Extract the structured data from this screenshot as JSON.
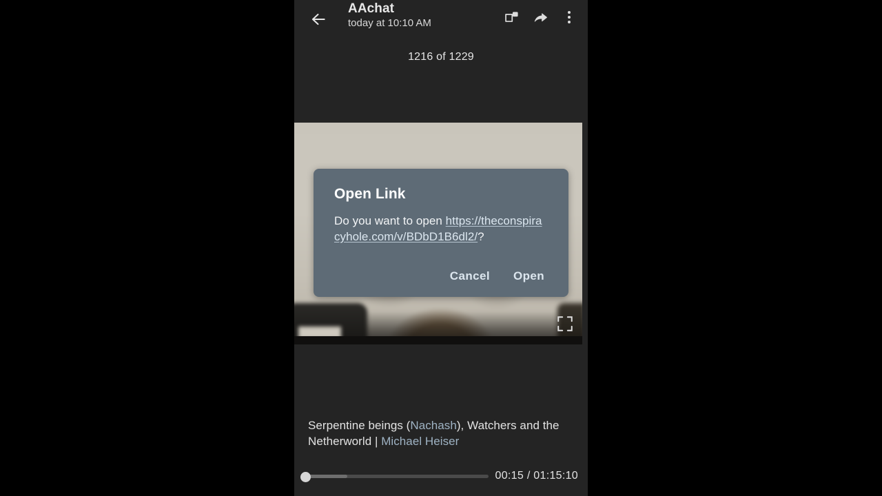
{
  "app": {
    "background_color": "#242424",
    "letterbox_color": "#000000"
  },
  "appbar": {
    "back_icon": "back-arrow-icon",
    "title": "AAchat",
    "subtitle": "today at 10:10 AM",
    "actions": [
      {
        "name": "picture-in-picture-icon",
        "label": "Picture in picture"
      },
      {
        "name": "share-icon",
        "label": "Share"
      },
      {
        "name": "overflow-menu-icon",
        "label": "More options"
      }
    ]
  },
  "counter": {
    "text": "1216 of 1229"
  },
  "media": {
    "fullscreen_icon": "fullscreen-icon",
    "description": "Blurred video frame of a person seated in front of a light beige wall"
  },
  "dialog": {
    "title": "Open Link",
    "message_prefix": "Do you want to open ",
    "url": "https://theconspiracyhole.com/v/BDbD1B6dl2/",
    "message_suffix": "?",
    "cancel_label": "Cancel",
    "open_label": "Open",
    "background_color": "#5e6b76",
    "button_color": "#dce6ee"
  },
  "caption": {
    "part1": "Serpentine beings (",
    "link1": "Nachash",
    "part2": "), Watchers and the Netherworld | ",
    "link2": "Michael Heiser",
    "link_color": "#9fb3c4"
  },
  "player": {
    "current_time": "00:15",
    "duration": "01:15:10",
    "time_display": "00:15 / 01:15:10",
    "progress_percent": 0.3,
    "buffered_percent": 24
  }
}
